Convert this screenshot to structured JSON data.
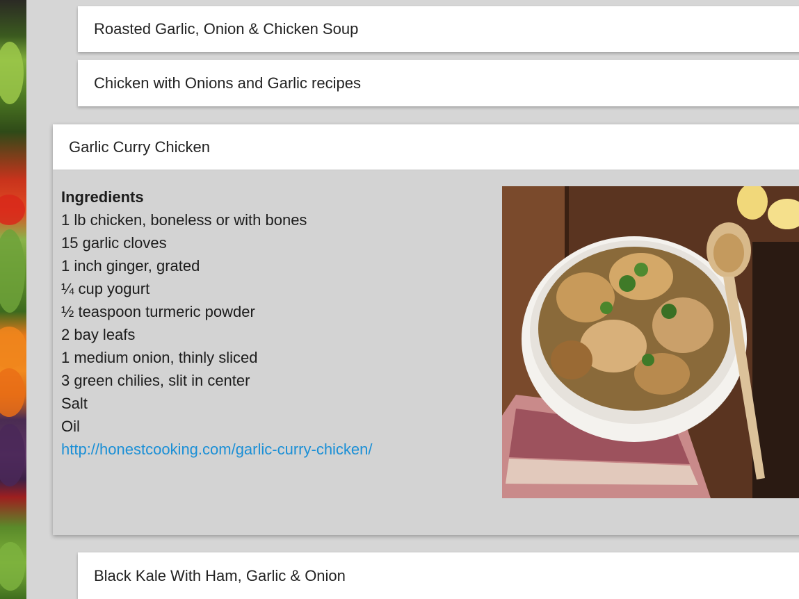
{
  "cards": {
    "soup_title": "Roasted Garlic, Onion & Chicken Soup",
    "onions_title": "Chicken with Onions and Garlic recipes",
    "kale_title": "Black Kale With Ham, Garlic & Onion"
  },
  "expanded": {
    "title": "Garlic Curry Chicken",
    "ingredients_heading": "Ingredients",
    "ingredients": [
      "1 lb chicken, boneless or with bones",
      "15 garlic cloves",
      "1 inch ginger, grated",
      "¼ cup yogurt",
      "½ teaspoon turmeric powder",
      "2 bay leafs",
      "1 medium onion, thinly sliced",
      "3 green chilies, slit in center",
      "Salt",
      "Oil"
    ],
    "link": "http://honestcooking.com/garlic-curry-chicken/"
  },
  "colors": {
    "background": "#d6d6d6",
    "card": "#ffffff",
    "link": "#1a8fd6"
  }
}
